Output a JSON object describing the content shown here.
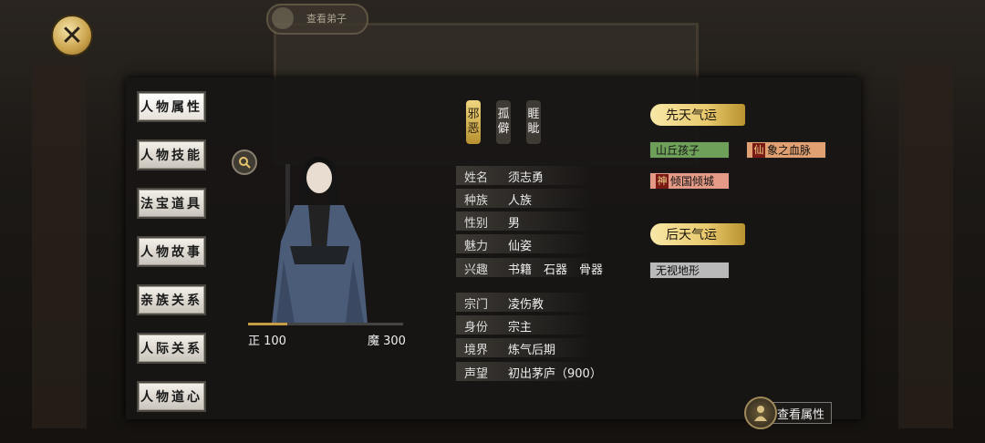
{
  "background": {
    "header_tab": "查看弟子"
  },
  "close_button": {
    "icon": "close-icon"
  },
  "tabs": [
    {
      "label": "人物属性",
      "active": true
    },
    {
      "label": "人物技能",
      "active": false
    },
    {
      "label": "法宝道具",
      "active": false
    },
    {
      "label": "人物故事",
      "active": false
    },
    {
      "label": "亲族关系",
      "active": false
    },
    {
      "label": "人际关系",
      "active": false
    },
    {
      "label": "人物道心",
      "active": false
    }
  ],
  "character": {
    "alignment": {
      "left_label": "正 100",
      "right_label": "魔 300",
      "fill_fraction": 0.25
    },
    "traits": [
      {
        "text": "邪恶",
        "style": "gold"
      },
      {
        "text": "孤僻",
        "style": "dark"
      },
      {
        "text": "睚眦",
        "style": "dark"
      }
    ],
    "info": [
      {
        "label": "姓名",
        "value": "须志勇"
      },
      {
        "label": "种族",
        "value": "人族"
      },
      {
        "label": "性别",
        "value": "男"
      },
      {
        "label": "魅力",
        "value": "仙姿"
      },
      {
        "label": "兴趣",
        "value": "书籍　石器　骨器"
      },
      {
        "label": "宗门",
        "value": "凌伤教"
      },
      {
        "label": "身份",
        "value": "宗主"
      },
      {
        "label": "境界",
        "value": "炼气后期"
      },
      {
        "label": "声望",
        "value": "初出茅庐（900）"
      }
    ]
  },
  "innate_luck": {
    "title": "先天气运",
    "badges": [
      {
        "text": "山丘孩子",
        "color": "#6ea05a",
        "seal": ""
      },
      {
        "text": "象之血脉",
        "color": "#e0a071",
        "seal": "仙"
      },
      {
        "text": "倾国倾城",
        "color": "#e49a86",
        "seal": "神"
      }
    ]
  },
  "acquired_luck": {
    "title": "后天气运",
    "badges": [
      {
        "text": "无视地形",
        "color": "#b9b9b9",
        "seal": ""
      }
    ]
  },
  "view_attributes": {
    "label": "查看属性"
  }
}
